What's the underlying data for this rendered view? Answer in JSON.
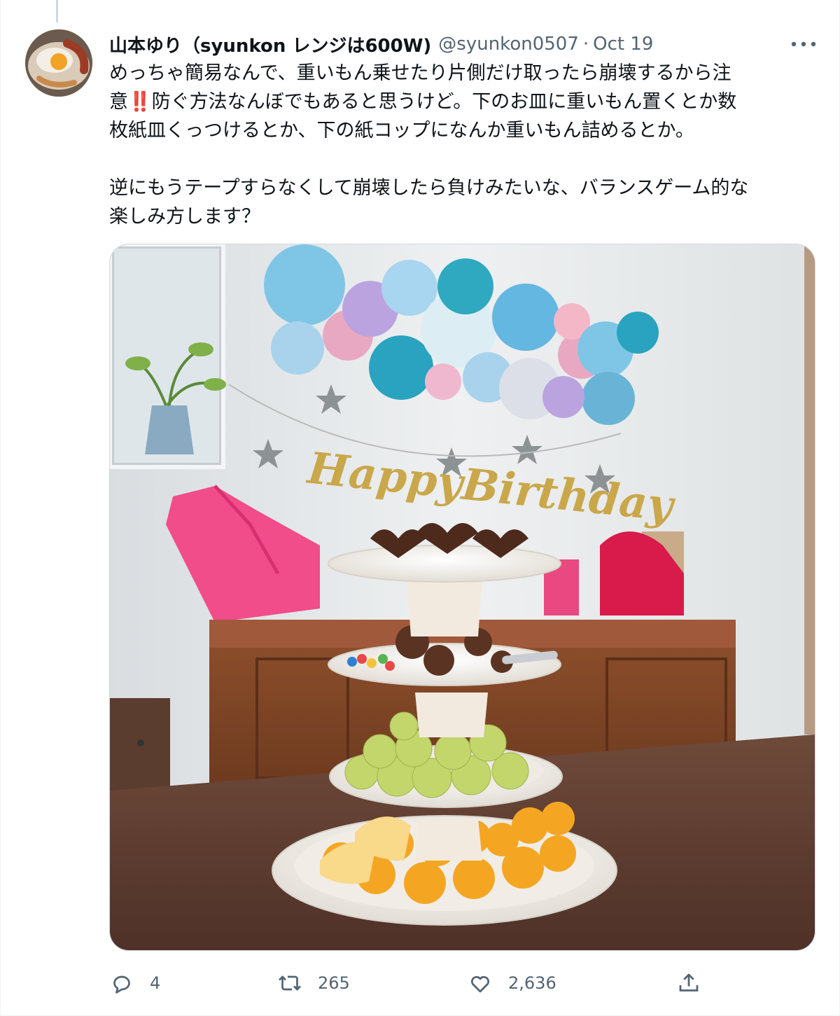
{
  "tweet": {
    "display_name": "山本ゆり（syunkon レンジは600W)",
    "handle": "@syunkon0507",
    "separator": "·",
    "date": "Oct 19",
    "text_part1": "めっちゃ簡易なんで、重いもん乗せたり片側だけ取ったら崩壊するから注\n意",
    "emoji": "‼️",
    "text_part2": "防ぐ方法なんぼでもあると思うけど。下のお皿に重いもん置くとか数\n枚紙皿くっつけるとか、下の紙コップになんか重いもん詰めるとか。\n\n逆にもうテープすらなくして崩壊したら負けみたいな、バランスゲーム的な\n楽しみ方します？",
    "photo_banner_text": "HappyBirthday"
  },
  "actions": {
    "reply_count": "4",
    "retweet_count": "265",
    "like_count": "2,636"
  },
  "icons": {
    "avatar": "avatar-food-photo",
    "more": "more-dots-icon",
    "reply": "reply-bubble-icon",
    "retweet": "retweet-arrows-icon",
    "like": "heart-icon",
    "share": "share-upload-icon"
  },
  "colors": {
    "text": "#0f1419",
    "secondary": "#536471",
    "border": "#cfd9de"
  }
}
